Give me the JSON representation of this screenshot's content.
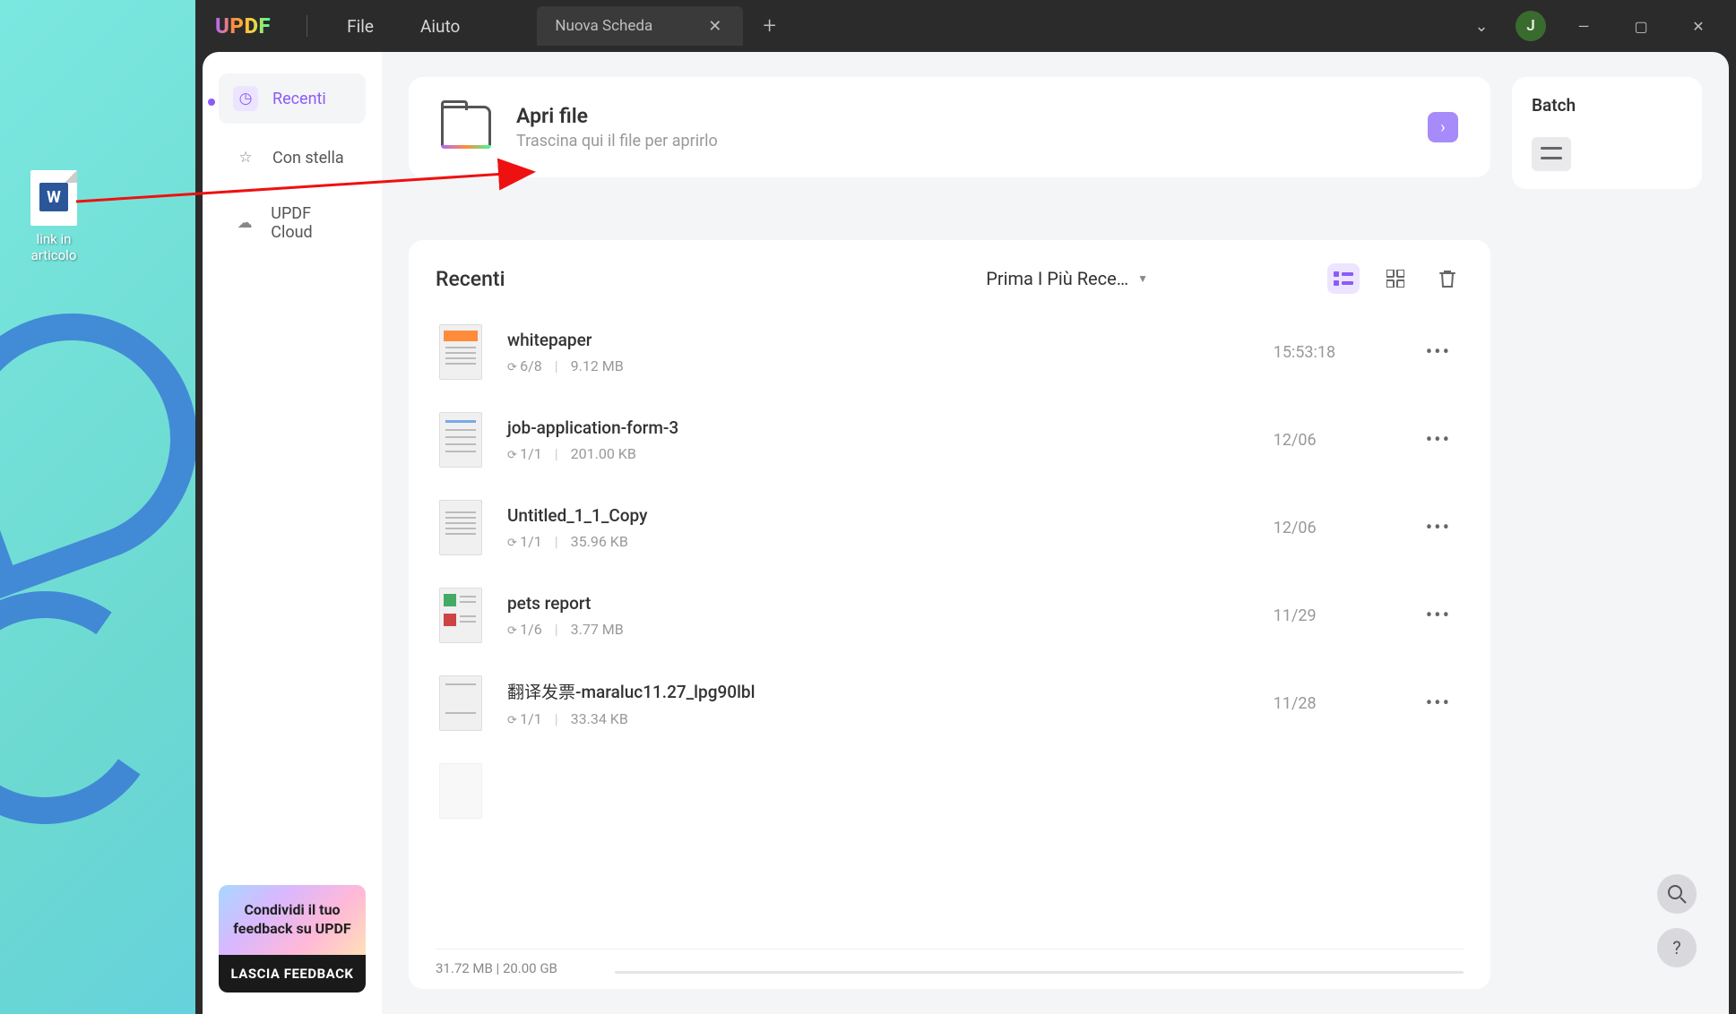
{
  "desktop_file_label": "link in articolo",
  "menu": {
    "file": "File",
    "help": "Aiuto"
  },
  "tab": {
    "title": "Nuova Scheda"
  },
  "avatar_letter": "J",
  "sidebar": {
    "recent": "Recenti",
    "starred": "Con stella",
    "cloud": "UPDF Cloud"
  },
  "feedback": {
    "line": "Condividi il tuo feedback su UPDF",
    "button": "LASCIA FEEDBACK"
  },
  "open_card": {
    "title": "Apri file",
    "subtitle": "Trascina qui il file per aprirlo"
  },
  "batch": {
    "title": "Batch"
  },
  "recent": {
    "title": "Recenti",
    "sort": "Prima I Più Rece…"
  },
  "files": {
    "0": {
      "name": "whitepaper",
      "pages": "6/8",
      "size": "9.12 MB",
      "date": "15:53:18"
    },
    "1": {
      "name": "job-application-form-3",
      "pages": "1/1",
      "size": "201.00 KB",
      "date": "12/06"
    },
    "2": {
      "name": "Untitled_1_1_Copy",
      "pages": "1/1",
      "size": "35.96 KB",
      "date": "12/06"
    },
    "3": {
      "name": "pets report",
      "pages": "1/6",
      "size": "3.77 MB",
      "date": "11/29"
    },
    "4": {
      "name": "翻译发票-maraluc11.27_lpg90lbl",
      "pages": "1/1",
      "size": "33.34 KB",
      "date": "11/28"
    }
  },
  "storage": {
    "text": "31.72 MB | 20.00 GB"
  }
}
